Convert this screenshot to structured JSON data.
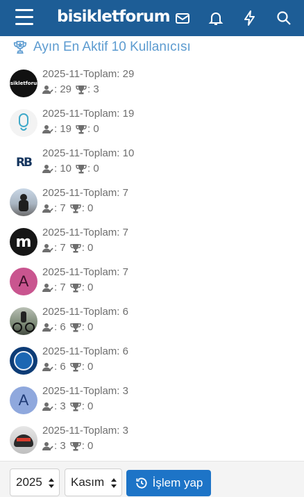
{
  "header": {
    "logo_text": "bisikletforum",
    "menu_icon": "hamburger-icon",
    "icons": [
      "envelope-icon",
      "bell-icon",
      "bolt-icon",
      "search-icon"
    ]
  },
  "heading": {
    "text": "Ayın En Aktif 10 Kullanıcısı",
    "icon": "trophy-icon"
  },
  "users": [
    {
      "line1": "2025-11-Toplam: 29",
      "posts": ": 29",
      "trophies": ": 3",
      "avatar": "bisikletforum-logo-avatar"
    },
    {
      "line1": "2025-11-Toplam: 19",
      "posts": ": 19",
      "trophies": ": 0",
      "avatar": "tqam-logo-avatar"
    },
    {
      "line1": "2025-11-Toplam: 10",
      "posts": ": 10",
      "trophies": ": 0",
      "avatar": "rb-logo-avatar"
    },
    {
      "line1": "2025-11-Toplam: 7",
      "posts": ": 7",
      "trophies": ": 0",
      "avatar": "cyclist-photo-avatar"
    },
    {
      "line1": "2025-11-Toplam: 7",
      "posts": ": 7",
      "trophies": ": 0",
      "avatar": "m-logo-avatar"
    },
    {
      "line1": "2025-11-Toplam: 7",
      "posts": ": 7",
      "trophies": ": 0",
      "avatar": "letter-a-avatar",
      "letter": "A"
    },
    {
      "line1": "2025-11-Toplam: 6",
      "posts": ": 6",
      "trophies": ": 0",
      "avatar": "bike-photo-avatar"
    },
    {
      "line1": "2025-11-Toplam: 6",
      "posts": ": 6",
      "trophies": ": 0",
      "avatar": "cycling-club-logo-avatar"
    },
    {
      "line1": "2025-11-Toplam: 3",
      "posts": ": 3",
      "trophies": ": 0",
      "avatar": "letter-a-avatar",
      "letter": "A"
    },
    {
      "line1": "2025-11-Toplam: 3",
      "posts": ": 3",
      "trophies": ": 0",
      "avatar": "helmet-photo-avatar"
    }
  ],
  "controls": {
    "year_value": "2025",
    "month_value": "Kasım",
    "submit_label": "İşlem yap"
  },
  "colors": {
    "header_bg": "#1d5d96",
    "heading": "#5c9bd0",
    "button": "#1d74c7"
  }
}
